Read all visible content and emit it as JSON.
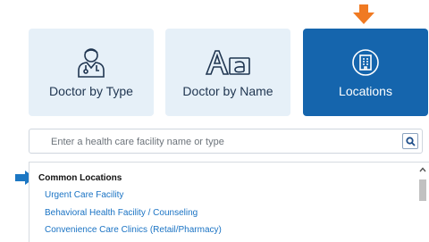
{
  "tiles": [
    {
      "label": "Doctor by Type",
      "icon": "doctor-icon"
    },
    {
      "label": "Doctor by Name",
      "icon": "font-icon"
    },
    {
      "label": "Locations",
      "icon": "building-icon"
    }
  ],
  "search": {
    "placeholder": "Enter a health care facility name or type",
    "value": ""
  },
  "dropdown": {
    "group_title": "Common Locations",
    "options": [
      "Urgent Care Facility",
      "Behavioral Health Facility / Counseling",
      "Convenience Care Clinics (Retail/Pharmacy)"
    ]
  },
  "colors": {
    "accent": "#1565ad",
    "tile_light": "#e6f0f8",
    "link": "#1a73c4",
    "callout_orange": "#f07a22",
    "callout_blue": "#1c77c3"
  }
}
